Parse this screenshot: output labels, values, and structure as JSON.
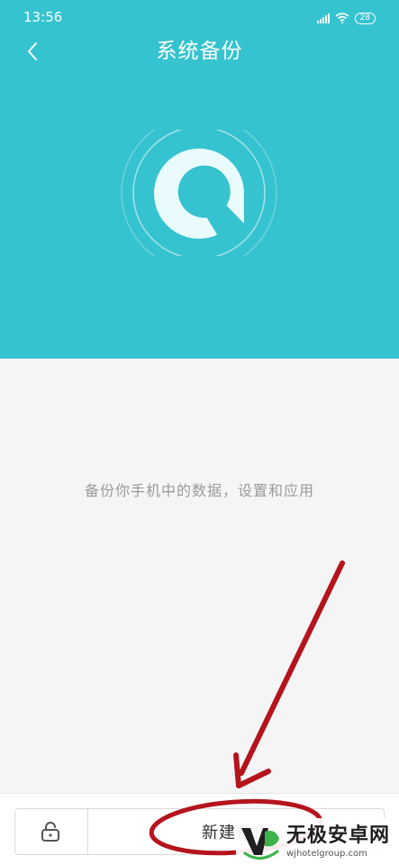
{
  "status_bar": {
    "time": "13:56",
    "battery": "28"
  },
  "header": {
    "title": "系统备份",
    "background_color": "#35c3cf",
    "back_icon": "chevron-left-icon",
    "logo_icon": "backup-logo-icon"
  },
  "content": {
    "description": "备份你手机中的数据，设置和应用"
  },
  "bottom_bar": {
    "lock_icon": "unlock-icon",
    "backup_label": "新建备份"
  },
  "watermark": {
    "brand": "无极安卓网",
    "url": "wjhotelgroup.com"
  },
  "colors": {
    "accent": "#35c3cf",
    "annotation": "#b5141c",
    "wm_green": "#3cb34a"
  }
}
